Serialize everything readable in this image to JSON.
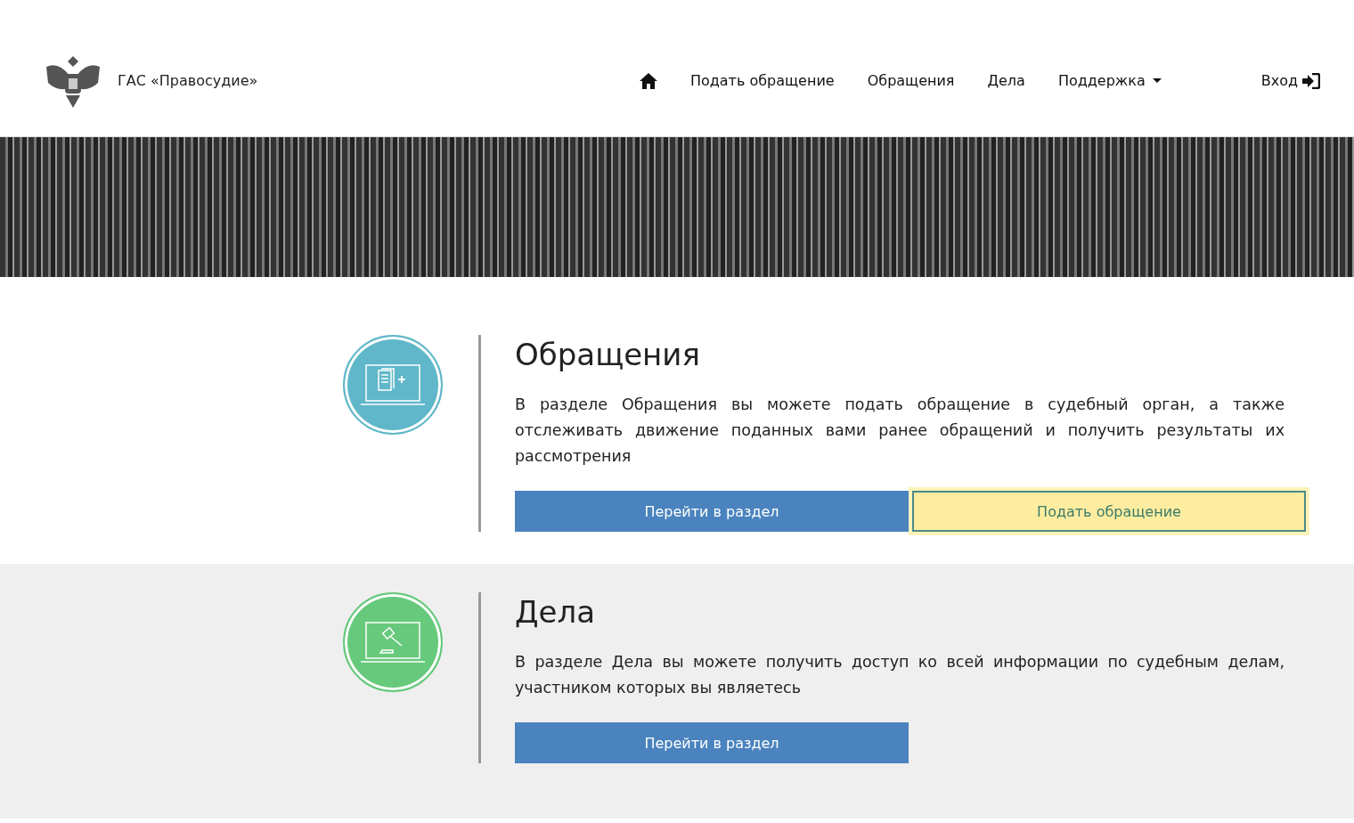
{
  "header": {
    "title": "ГАС «Правосудие»",
    "nav": [
      {
        "kind": "home"
      },
      {
        "kind": "link",
        "label": "Подать обращение"
      },
      {
        "kind": "link",
        "label": "Обращения"
      },
      {
        "kind": "link",
        "label": "Дела"
      },
      {
        "kind": "dropdown",
        "label": "Поддержка"
      }
    ],
    "login": "Вход"
  },
  "sections": [
    {
      "kind": "documents",
      "color": "#5fb7c9",
      "title": "Обращения",
      "text": "В разделе Обращения вы можете подать обращение в судебный орган, а также отслеживать движение поданных вами ранее обращений и получить результаты их рассмотрения",
      "buttons": [
        {
          "label": "Перейти в раздел",
          "highlighted": false
        },
        {
          "label": "Подать обращение",
          "highlighted": true
        }
      ]
    },
    {
      "kind": "gavel",
      "color": "#66c97b",
      "title": "Дела",
      "text": "В разделе Дела вы можете получить доступ ко всей информации по судебным делам, участником которых вы являетесь",
      "buttons": [
        {
          "label": "Перейти в раздел",
          "highlighted": false
        }
      ]
    }
  ]
}
